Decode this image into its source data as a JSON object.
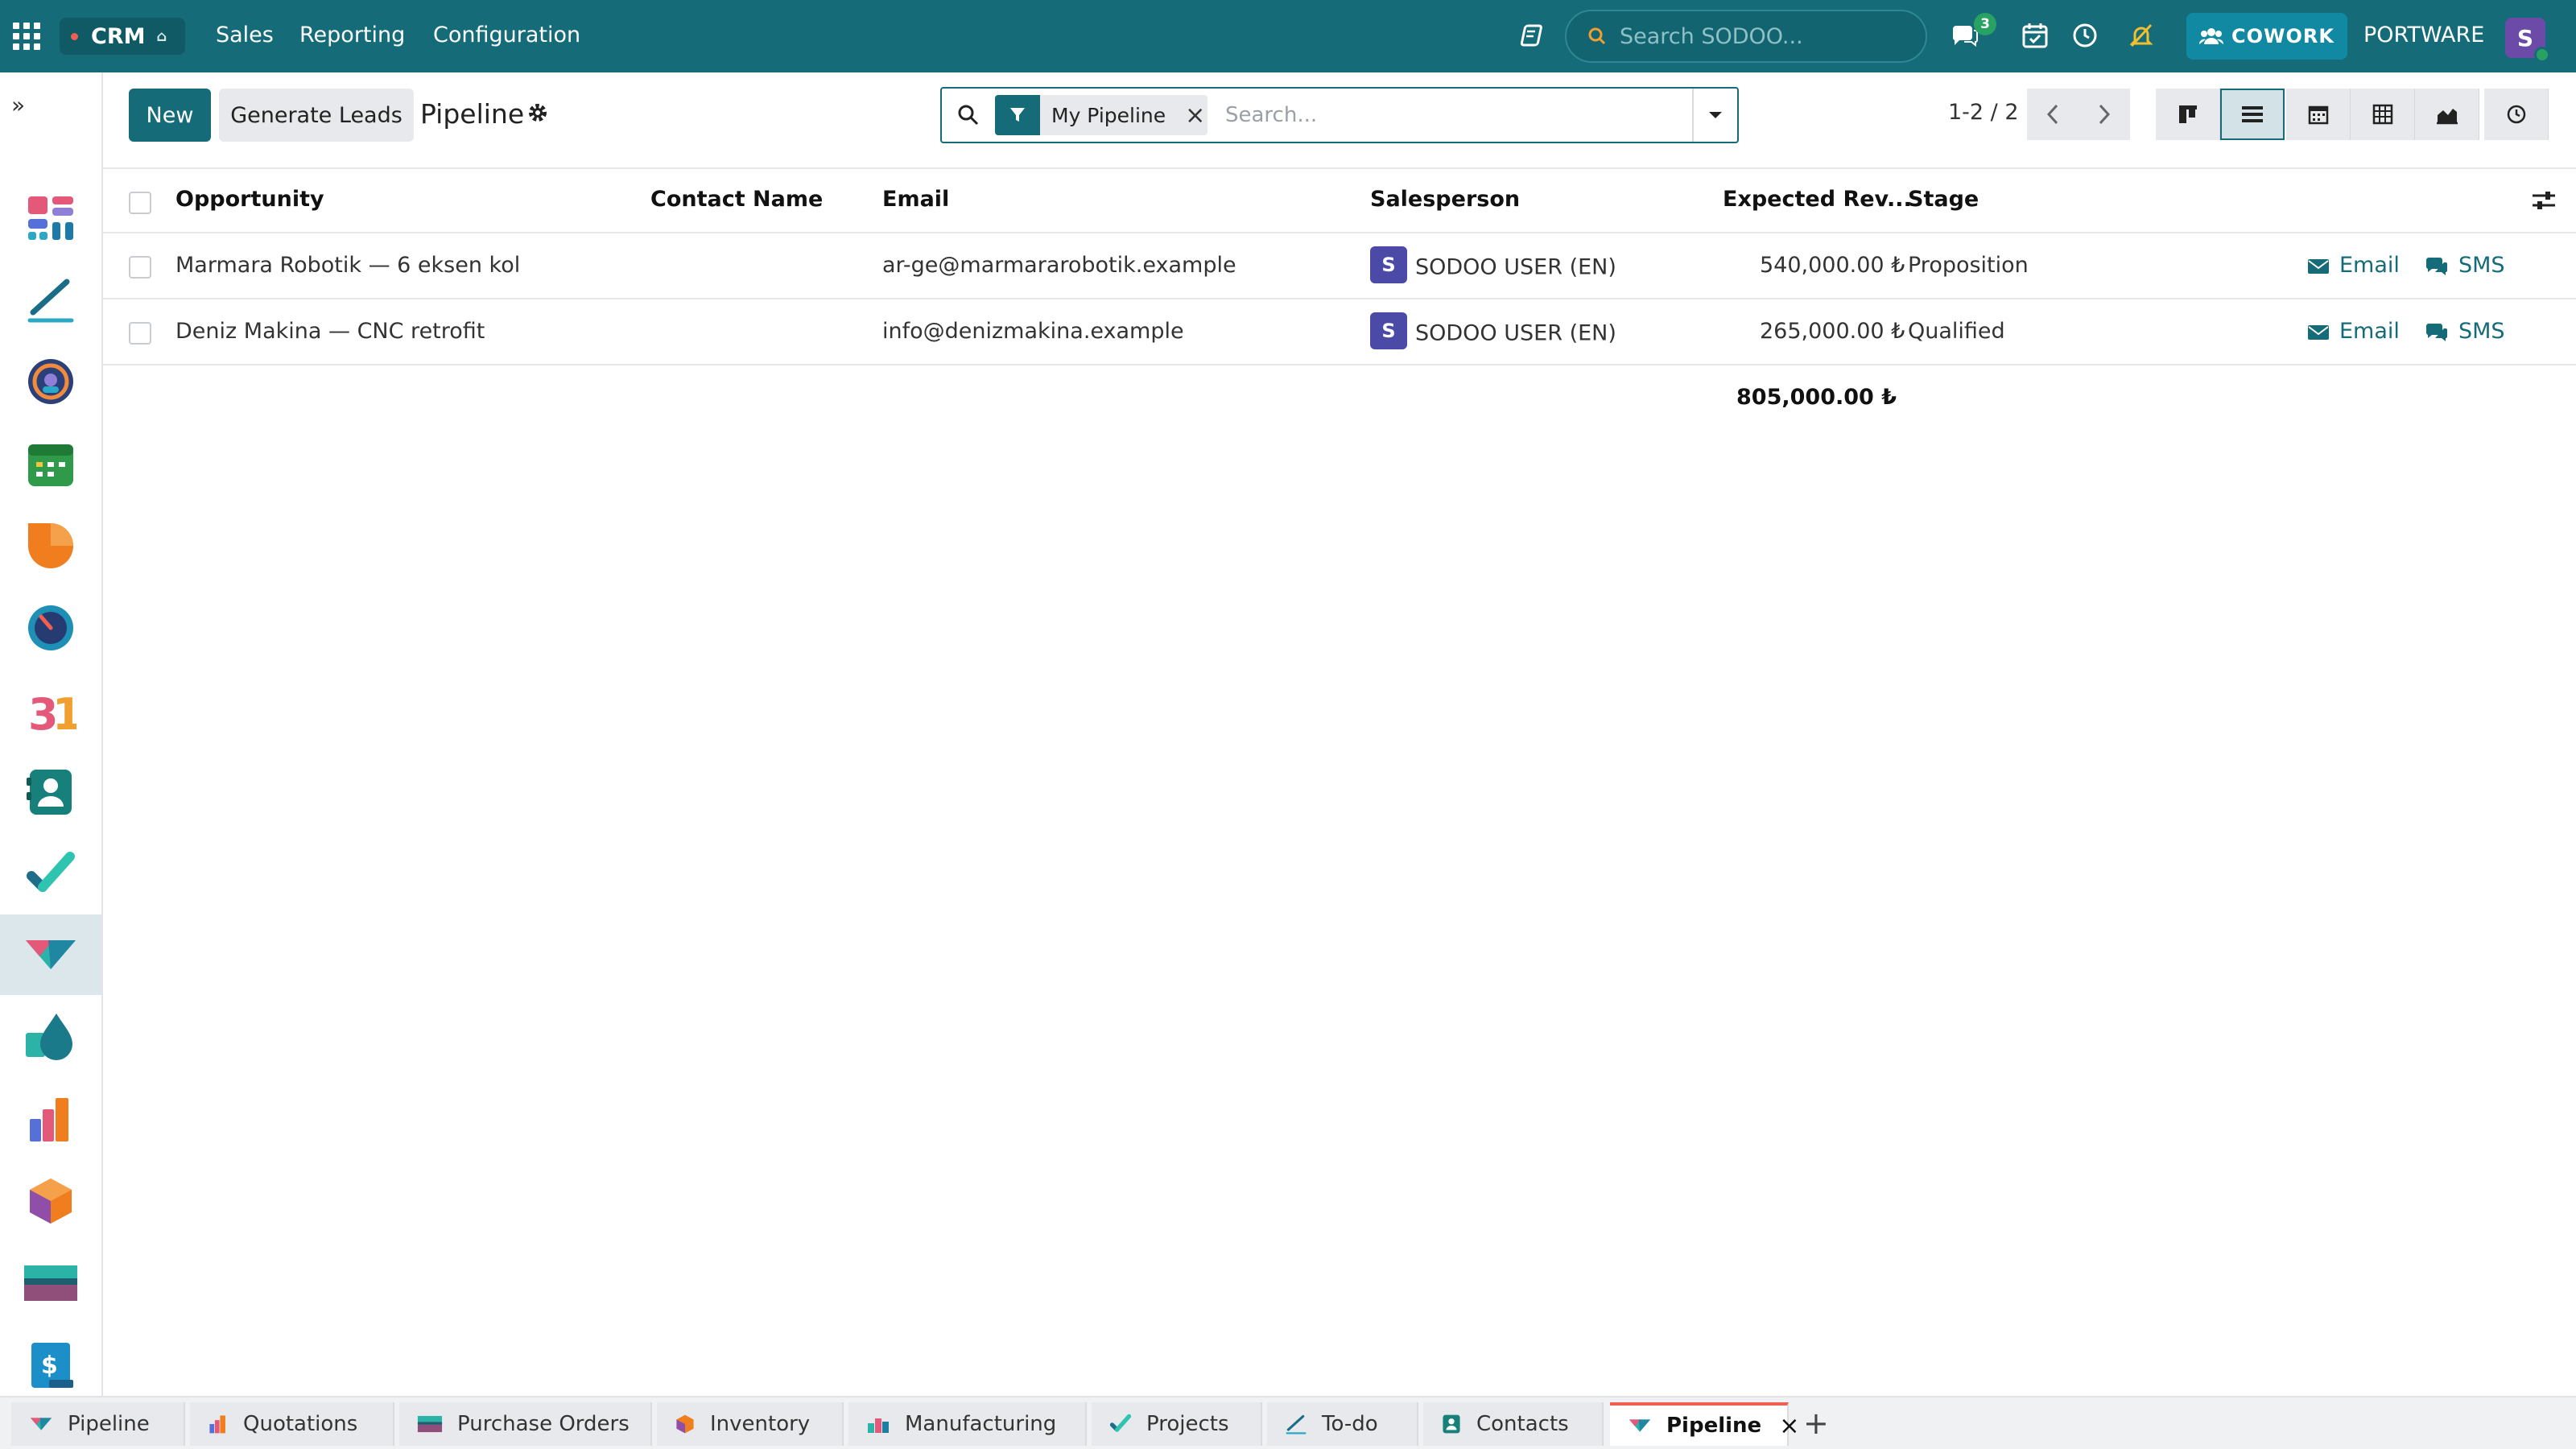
{
  "topbar": {
    "app_name": "CRM",
    "menu": [
      "Sales",
      "Reporting",
      "Configuration"
    ],
    "search_placeholder": "Search SODOO...",
    "messages_count": "3",
    "cowork_label": "COWORK",
    "company": "PORTWARE",
    "user_initial": "S"
  },
  "sidebar": {
    "apps": [
      "dashboard-icon",
      "sign-pen-icon",
      "discuss-icon",
      "planning-calendar-icon",
      "sales-icon",
      "timesheet-icon",
      "calendar-31-icon",
      "contacts-icon",
      "todo-icon",
      "crm-icon",
      "inventory-drop-icon",
      "reporting-bars-icon",
      "products-cube-icon",
      "purchase-card-icon",
      "invoicing-icon"
    ],
    "active_app": "crm-icon"
  },
  "control_panel": {
    "new_label": "New",
    "generate_label": "Generate Leads",
    "title": "Pipeline",
    "filter_facet": "My Pipeline",
    "search_placeholder": "Search...",
    "pager": "1-2 / 2",
    "views": [
      "kanban",
      "list",
      "calendar",
      "pivot",
      "graph",
      "activity"
    ],
    "active_view": "list"
  },
  "list": {
    "columns": [
      "Opportunity",
      "Contact Name",
      "Email",
      "Salesperson",
      "Expected Rev...",
      "Stage"
    ],
    "rows": [
      {
        "opportunity": "Marmara Robotik — 6 eksen kol",
        "contact": "",
        "email": "ar-ge@marmararobotik.example",
        "salesperson_initial": "S",
        "salesperson": "SODOO USER (EN)",
        "revenue": "540,000.00 ₺",
        "stage": "Proposition",
        "action_email": "Email",
        "action_sms": "SMS"
      },
      {
        "opportunity": "Deniz Makina — CNC retrofit",
        "contact": "",
        "email": "info@denizmakina.example",
        "salesperson_initial": "S",
        "salesperson": "SODOO USER (EN)",
        "revenue": "265,000.00 ₺",
        "stage": "Qualified",
        "action_email": "Email",
        "action_sms": "SMS"
      }
    ],
    "total_revenue": "805,000.00 ₺"
  },
  "tabbar": {
    "tabs": [
      "Pipeline",
      "Quotations",
      "Purchase Orders",
      "Inventory",
      "Manufacturing",
      "Projects",
      "To-do",
      "Contacts",
      "Pipeline"
    ],
    "active_index": 8
  },
  "colors": {
    "primary": "#156b77",
    "navbar": "#156b77",
    "salesperson_avatar": "#4b4aa7",
    "user_avatar": "#6c4ba8",
    "online": "#27a263"
  }
}
